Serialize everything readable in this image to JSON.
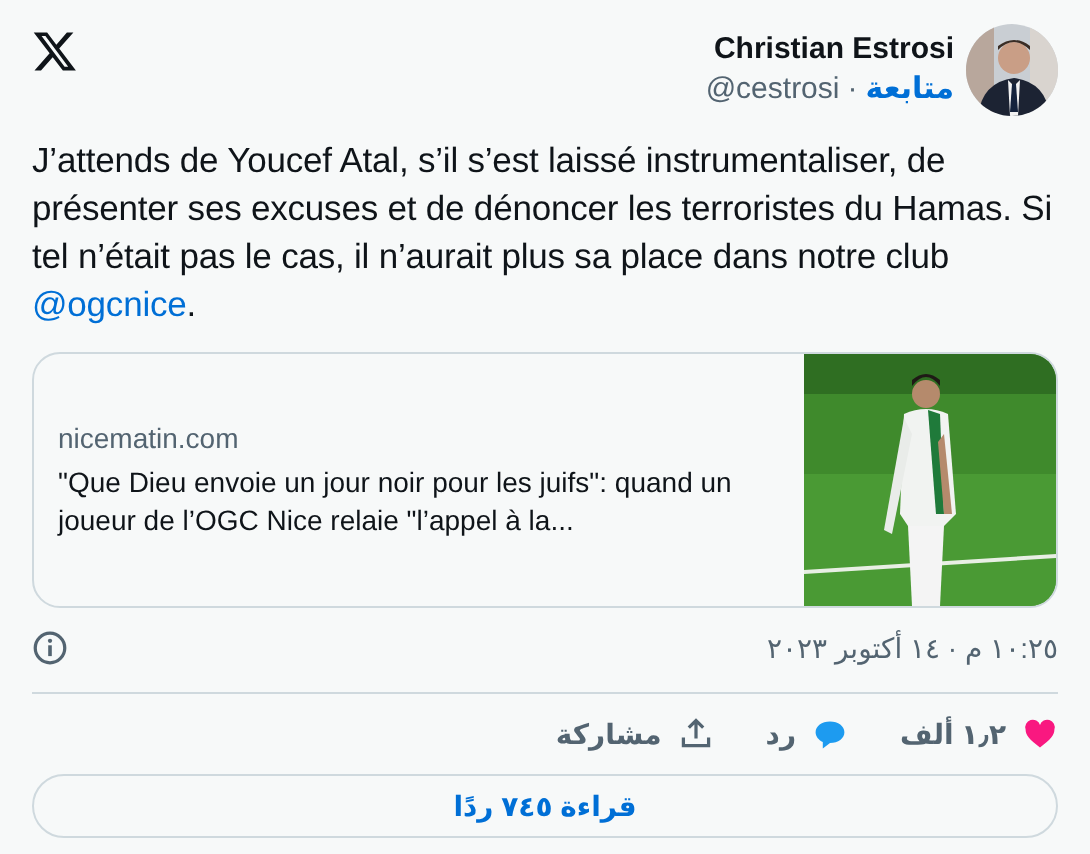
{
  "author": {
    "name": "Christian Estrosi",
    "handle": "@cestrosi",
    "follow": "متابعة",
    "separator": "·"
  },
  "tweet": {
    "text": "J’attends de Youcef Atal, s’il s’est laissé instrumentaliser, de présenter ses excuses et de dénoncer les terroristes du Hamas. Si tel n’était pas le cas, il n’aurait plus sa place dans notre club ",
    "link": "@ogcnice",
    "text_end": "."
  },
  "card": {
    "domain": "nicematin.com",
    "title": "\"Que Dieu envoie un jour noir pour les juifs\": quand un joueur de l’OGC Nice relaie \"l’appel à la..."
  },
  "timestamp": "١٠:٢٥ م · ١٤ أكتوبر ٢٠٢٣",
  "actions": [
    {
      "kind": "like",
      "label": "١٫٢ ألف"
    },
    {
      "kind": "reply",
      "label": "رد"
    },
    {
      "kind": "share",
      "label": "مشاركة"
    }
  ],
  "read_replies": "قراءة ٧٤٥ ردًا"
}
